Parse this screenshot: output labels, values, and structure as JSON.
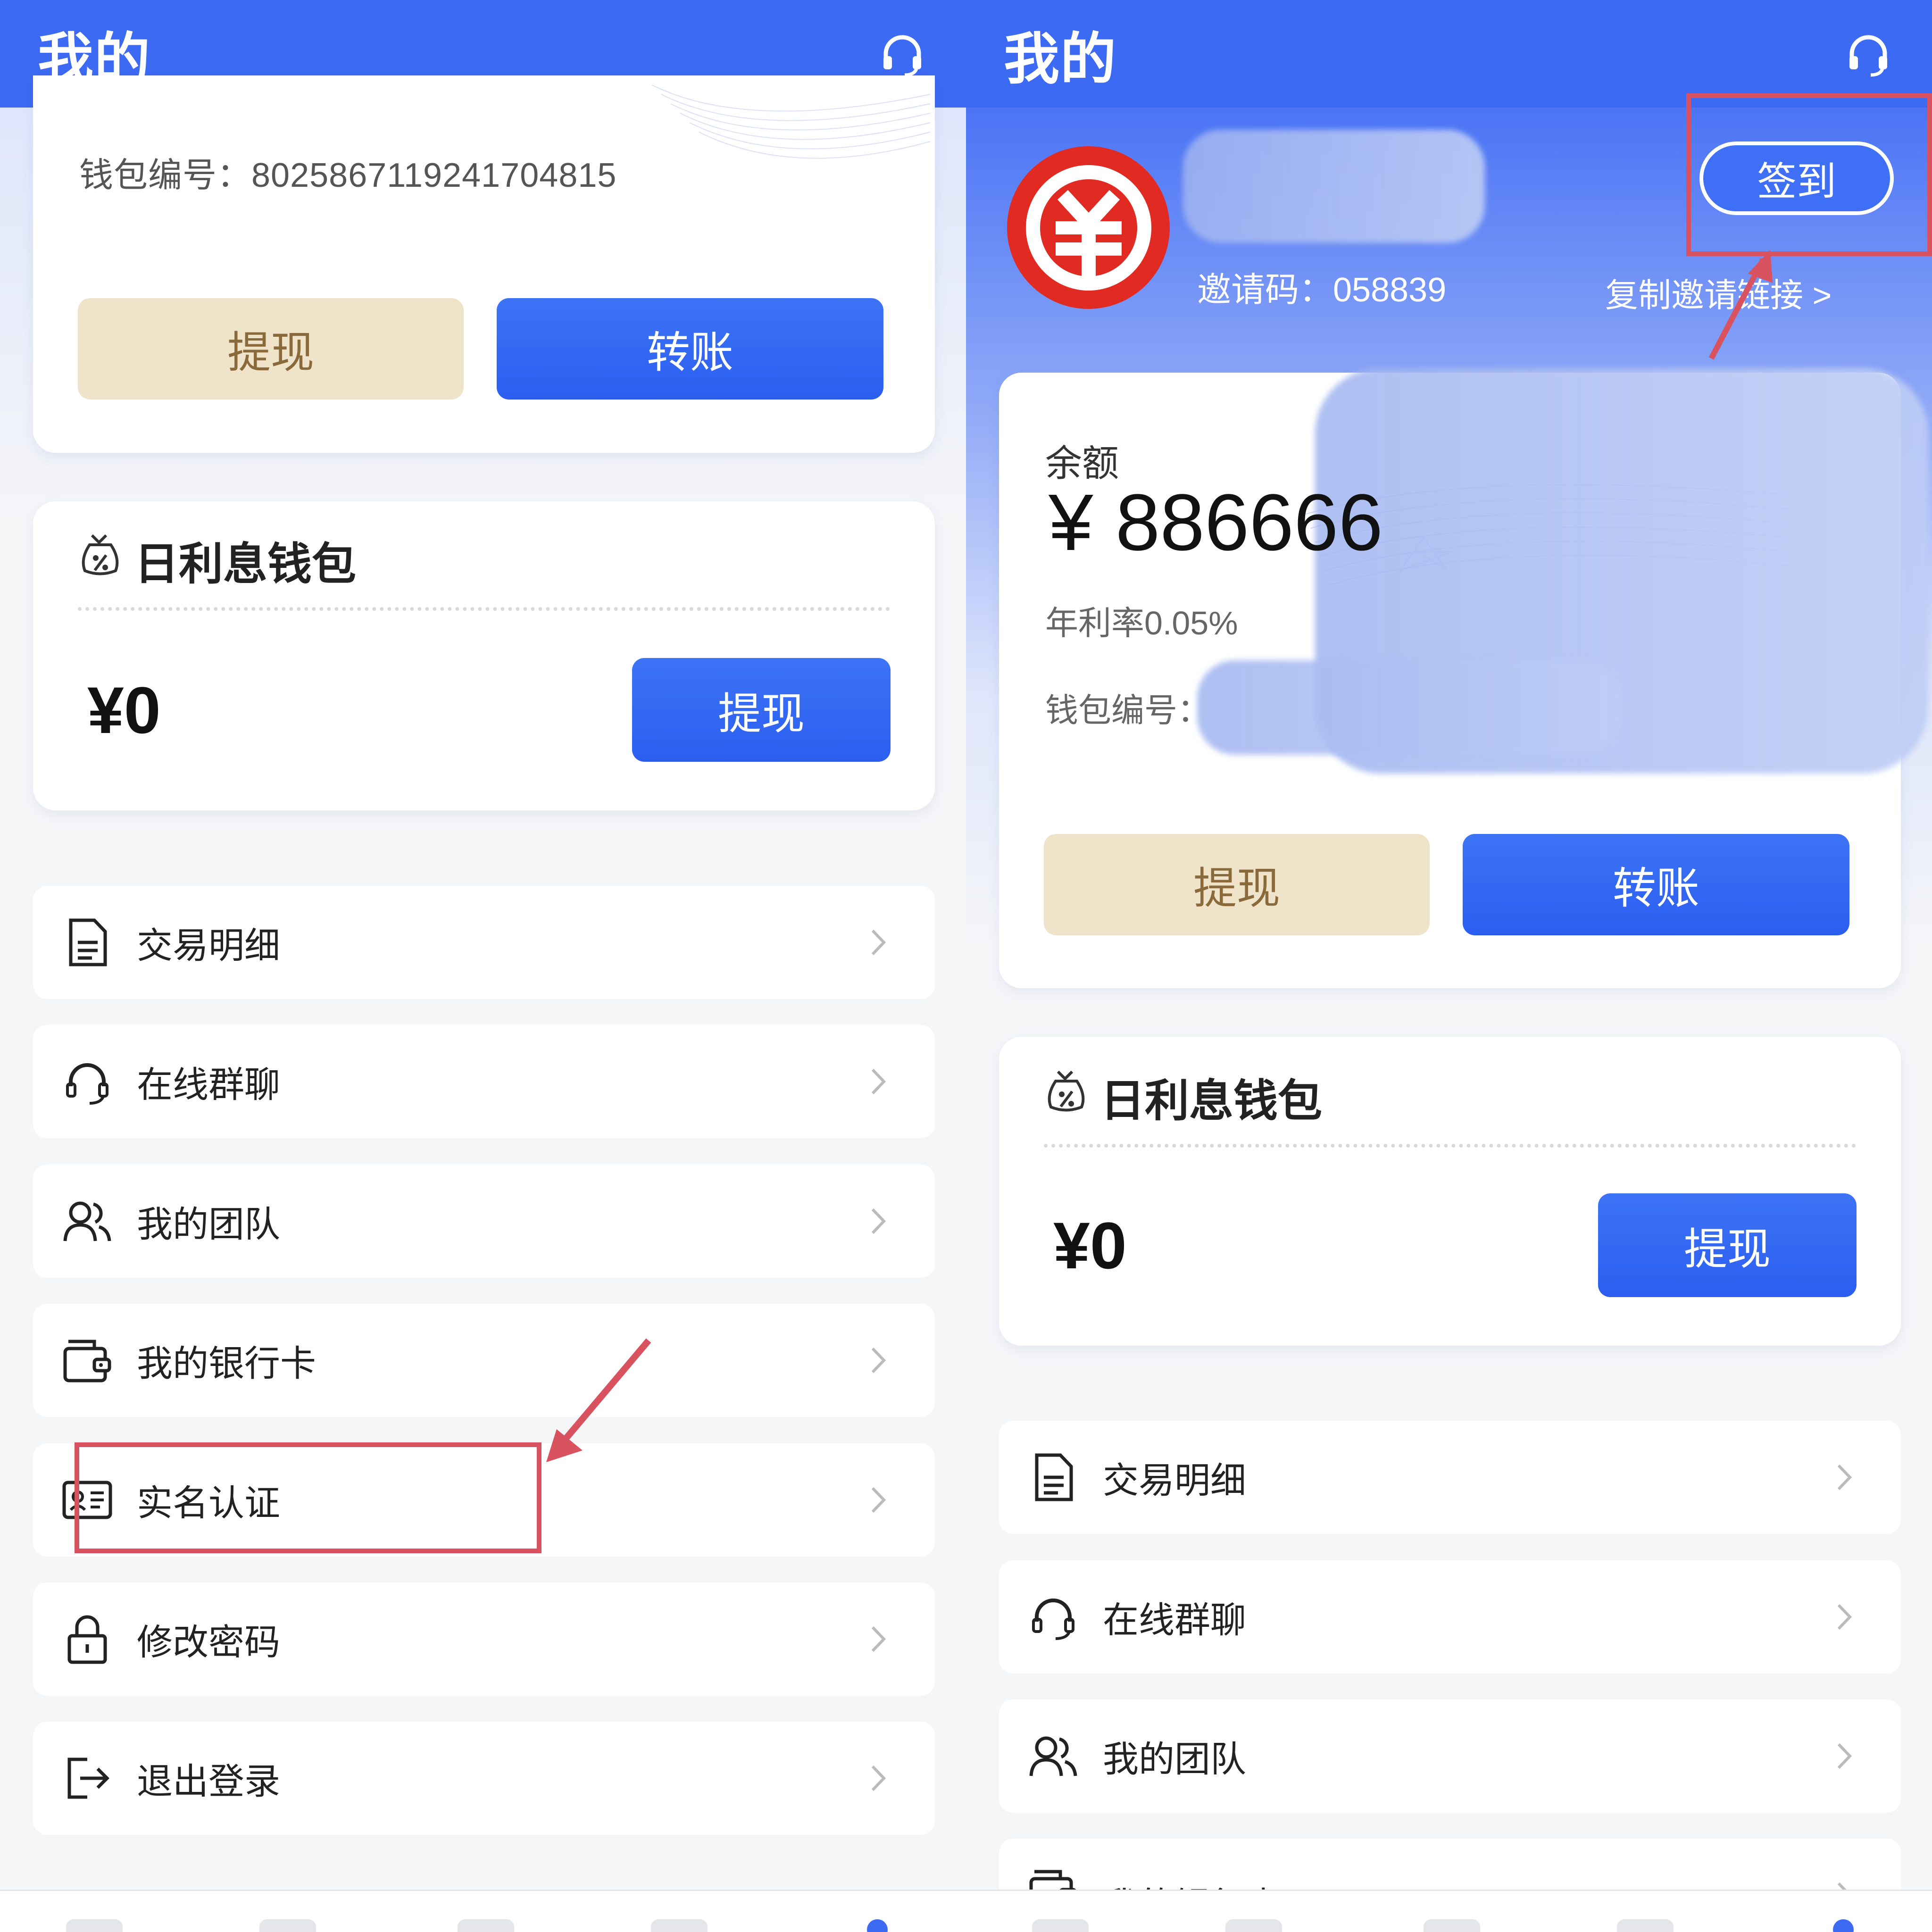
{
  "colors": {
    "header_blue": "#3d6af2",
    "button_blue": "#2b5ef0",
    "button_beige": "#efe3c9",
    "highlight_red": "#d9525f",
    "logo_red": "#e02a22"
  },
  "left": {
    "header": {
      "title": "我的",
      "support_icon": "headset-icon"
    },
    "wallet_card": {
      "wallet_no": "钱包编号：8025867119241704815",
      "withdraw_label": "提现",
      "transfer_label": "转账"
    },
    "interest_wallet": {
      "title": "日利息钱包",
      "icon": "money-bag-percent-icon",
      "amount": "¥0",
      "withdraw_label": "提现"
    },
    "menu": [
      {
        "label": "交易明细",
        "icon": "document-icon"
      },
      {
        "label": "在线群聊",
        "icon": "headset-icon"
      },
      {
        "label": "我的团队",
        "icon": "users-icon"
      },
      {
        "label": "我的银行卡",
        "icon": "wallet-card-icon"
      },
      {
        "label": "实名认证",
        "icon": "id-card-icon"
      },
      {
        "label": "修改密码",
        "icon": "lock-icon"
      },
      {
        "label": "退出登录",
        "icon": "logout-icon"
      }
    ]
  },
  "right": {
    "header": {
      "title": "我的",
      "support_icon": "headset-icon"
    },
    "profile": {
      "logo_icon": "digital-yuan-logo-icon",
      "invite_code": "邀请码：058839",
      "checkin_label": "签到",
      "copy_link_label": "复制邀请链接 >"
    },
    "balance_card": {
      "balance_label": "余额",
      "balance": "¥ 886666",
      "annual_rate": "年利率0.05%",
      "wallet_no_label": "钱包编号：",
      "withdraw_label": "提现",
      "transfer_label": "转账"
    },
    "interest_wallet": {
      "title": "日利息钱包",
      "icon": "money-bag-percent-icon",
      "amount": "¥0",
      "withdraw_label": "提现"
    },
    "menu": [
      {
        "label": "交易明细",
        "icon": "document-icon"
      },
      {
        "label": "在线群聊",
        "icon": "headset-icon"
      },
      {
        "label": "我的团队",
        "icon": "users-icon"
      },
      {
        "label": "我的银行卡",
        "icon": "wallet-card-icon"
      }
    ]
  }
}
